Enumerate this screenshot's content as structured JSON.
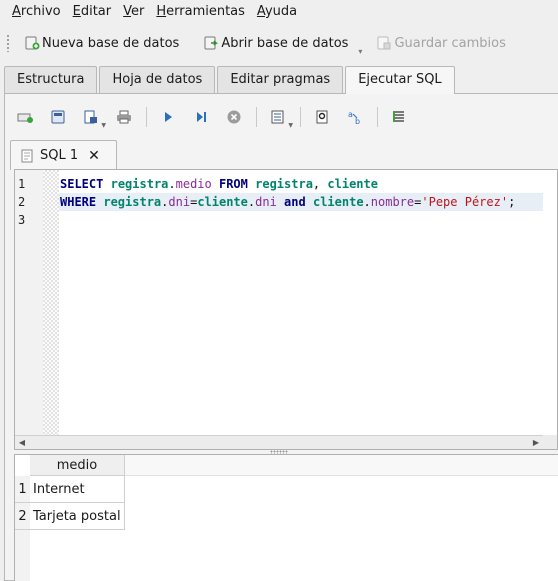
{
  "menubar": {
    "items": [
      {
        "accel": "A",
        "rest": "rchivo"
      },
      {
        "accel": "E",
        "rest": "ditar"
      },
      {
        "accel": "V",
        "rest": "er"
      },
      {
        "accel": "H",
        "rest": "erramientas"
      },
      {
        "accel": "A",
        "rest": "yuda"
      }
    ]
  },
  "toolbar": {
    "new_db_label": "Nueva base de datos",
    "open_db_label": "Abrir base de datos",
    "save_changes_label": "Guardar cambios"
  },
  "tabs": [
    "Estructura",
    "Hoja de datos",
    "Editar pragmas",
    "Ejecutar SQL"
  ],
  "active_tab": "Ejecutar SQL",
  "editor": {
    "tab_label": "SQL 1",
    "close_glyph": "✕",
    "line_numbers": [
      "1",
      "2",
      "3"
    ],
    "line1": {
      "kw_select": "SELECT",
      "t1": "registra",
      "dot1": ".",
      "c1": "medio",
      "kw_from": "FROM",
      "t2": "registra",
      "comma": ",",
      "t3": "cliente"
    },
    "line2": {
      "kw_where": "WHERE",
      "t1": "registra",
      "dot1": ".",
      "c1": "dni",
      "eq1": "=",
      "t2": "cliente",
      "dot2": ".",
      "c2": "dni",
      "kw_and": "and",
      "t3": "cliente",
      "dot3": ".",
      "c3": "nombre",
      "eq2": "=",
      "str": "'Pepe Pérez'",
      "semi": ";"
    }
  },
  "results": {
    "column_header": "medio",
    "rows": [
      {
        "num": "1",
        "medio": "Internet"
      },
      {
        "num": "2",
        "medio": "Tarjeta postal"
      }
    ]
  }
}
